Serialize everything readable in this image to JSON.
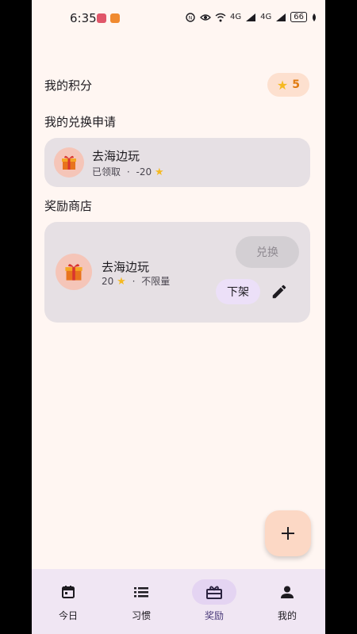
{
  "status_bar": {
    "time": "6:35",
    "network_1": "4G",
    "network_2": "4G",
    "battery": "66"
  },
  "points": {
    "title": "我的积分",
    "value": "5",
    "icon": "star-icon",
    "accent": "#e07a10"
  },
  "requests": {
    "title": "我的兑换申请",
    "items": [
      {
        "name": "去海边玩",
        "status": "已领取",
        "separator": "·",
        "cost": "-20",
        "icon": "gift-icon"
      }
    ]
  },
  "shop": {
    "title": "奖励商店",
    "items": [
      {
        "name": "去海边玩",
        "cost": "20",
        "separator": "·",
        "limit": "不限量",
        "redeem_label": "兑换",
        "unshelve_label": "下架",
        "icon": "gift-icon"
      }
    ]
  },
  "fab": {
    "icon": "plus-icon"
  },
  "nav": {
    "items": [
      {
        "label": "今日",
        "icon": "calendar-icon",
        "active": false
      },
      {
        "label": "习惯",
        "icon": "list-icon",
        "active": false
      },
      {
        "label": "奖励",
        "icon": "gift-box-icon",
        "active": true
      },
      {
        "label": "我的",
        "icon": "person-icon",
        "active": false
      }
    ]
  }
}
